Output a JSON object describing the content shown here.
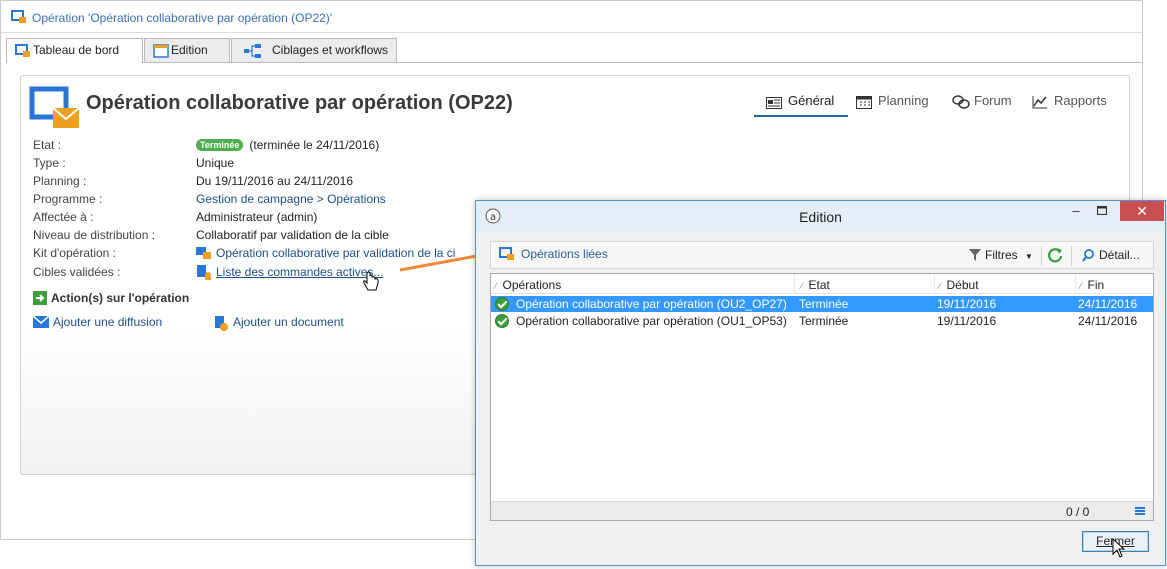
{
  "window": {
    "title": "Opération 'Opération collaborative par opération  (OP22)'"
  },
  "tabs": [
    {
      "label": "Tableau de bord",
      "icon": "dashboard-icon",
      "active": true
    },
    {
      "label": "Edition",
      "icon": "edit-window-icon",
      "active": false
    },
    {
      "label": "Ciblages et workflows",
      "icon": "workflow-icon",
      "active": false
    }
  ],
  "operation": {
    "title": "Opération collaborative par opération (OP22)",
    "icon": "operation-envelope-icon"
  },
  "view_tabs": [
    {
      "label": "Général",
      "icon": "general-icon",
      "active": true
    },
    {
      "label": "Planning",
      "icon": "calendar-icon",
      "active": false
    },
    {
      "label": "Forum",
      "icon": "forum-icon",
      "active": false
    },
    {
      "label": "Rapports",
      "icon": "chart-icon",
      "active": false
    }
  ],
  "fields": {
    "etat": {
      "label": "Etat :",
      "badge": "Terminée",
      "value": "(terminée le 24/11/2016)"
    },
    "type": {
      "label": "Type :",
      "value": "Unique"
    },
    "planning": {
      "label": "Planning :",
      "value": "Du 19/11/2016 au 24/11/2016"
    },
    "programme": {
      "label": "Programme :",
      "value": "Gestion de campagne > Opérations"
    },
    "affectee": {
      "label": "Affectée à :",
      "value": "Administrateur (admin)"
    },
    "niveau": {
      "label": "Niveau de distribution :",
      "value": "Collaboratif par validation de la cible"
    },
    "kit": {
      "label": "Kit d'opération :",
      "value": "Opération collaborative par validation de la ci"
    },
    "cibles": {
      "label": "Cibles validées :",
      "value": "Liste des commandes actives..."
    }
  },
  "actions": {
    "title": "Action(s) sur l'opération",
    "add_delivery": "Ajouter une diffusion",
    "add_document": "Ajouter un document"
  },
  "dialog": {
    "title": "Edition",
    "toolbar": {
      "linked_ops": "Opérations liées",
      "filters": "Filtres",
      "detail": "Détail..."
    },
    "columns": [
      "Opérations",
      "Etat",
      "Début",
      "Fin"
    ],
    "rows": [
      {
        "name": "Opération collaborative par opération  (OU2_OP27)",
        "state": "Terminée",
        "start": "19/11/2016",
        "end": "24/11/2016",
        "selected": true
      },
      {
        "name": "Opération collaborative par opération  (OU1_OP53)",
        "state": "Terminée",
        "start": "19/11/2016",
        "end": "24/11/2016",
        "selected": false
      }
    ],
    "count": "0 / 0",
    "close_label": "Fermer"
  },
  "colors": {
    "accent": "#1c4f8c",
    "selection": "#3399ff",
    "status_done": "#4caf50",
    "arrow": "#f0883a"
  }
}
